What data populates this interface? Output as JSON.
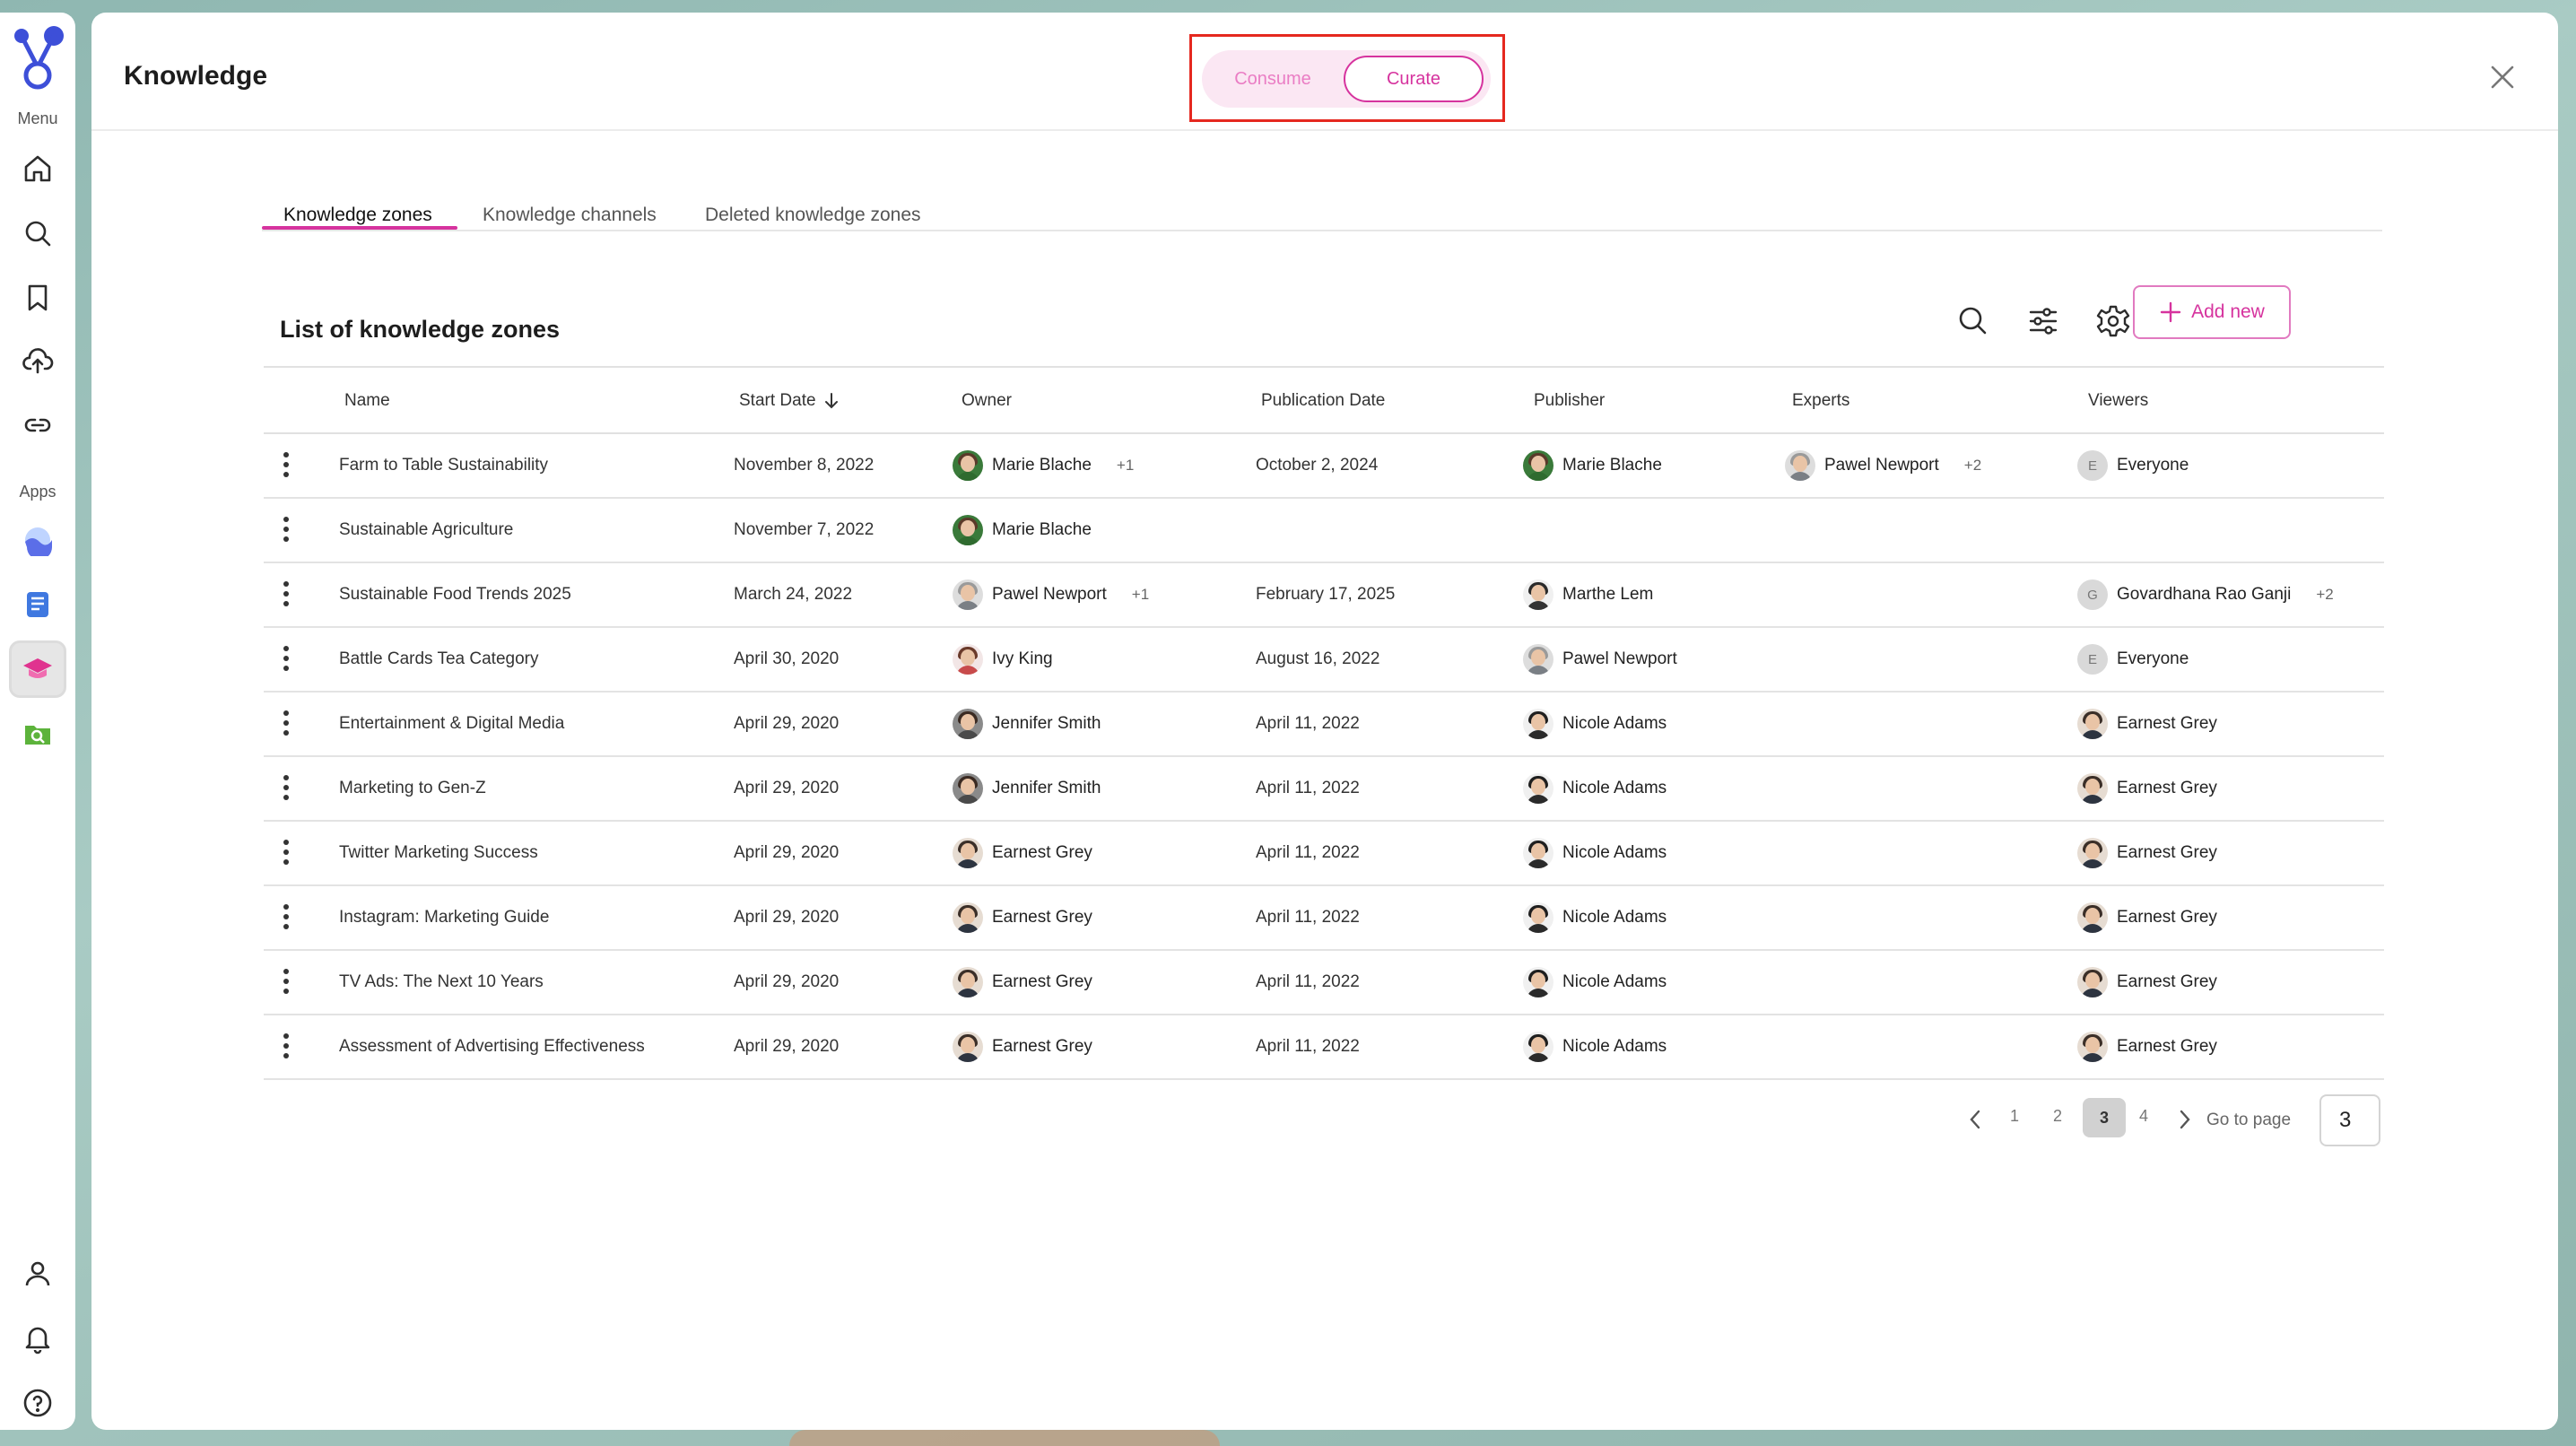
{
  "rail": {
    "menu_label": "Menu",
    "apps_label": "Apps",
    "menu_items": [
      "home-icon",
      "search-icon",
      "bookmark-icon",
      "upload-cloud-icon",
      "link-icon"
    ],
    "app_items": [
      "wave-app-icon",
      "document-app-icon",
      "knowledge-app-icon",
      "search-folder-app-icon"
    ],
    "bottom_items": [
      "user-icon",
      "bell-icon",
      "help-icon"
    ]
  },
  "header": {
    "title": "Knowledge",
    "toggle": {
      "consume": "Consume",
      "curate": "Curate",
      "selected": "Curate"
    }
  },
  "tabs": [
    {
      "label": "Knowledge zones",
      "active": true
    },
    {
      "label": "Knowledge channels",
      "active": false
    },
    {
      "label": "Deleted knowledge zones",
      "active": false
    }
  ],
  "list": {
    "title": "List of knowledge zones",
    "add_label": "Add new",
    "columns": [
      "Name",
      "Start Date",
      "Owner",
      "Publication Date",
      "Publisher",
      "Experts",
      "Viewers"
    ]
  },
  "rows": [
    {
      "name": "Farm to Table Sustainability",
      "start": "November 8, 2022",
      "owner": "Marie Blache",
      "owner_extra": "+1",
      "pub": "October 2, 2024",
      "publisher": "Marie Blache",
      "experts": "Pawel Newport",
      "experts_extra": "+2",
      "viewers": "Everyone",
      "viewers_extra": ""
    },
    {
      "name": "Sustainable Agriculture",
      "start": "November 7, 2022",
      "owner": "Marie Blache",
      "owner_extra": "",
      "pub": "",
      "publisher": "",
      "experts": "",
      "experts_extra": "",
      "viewers": "",
      "viewers_extra": ""
    },
    {
      "name": "Sustainable Food Trends 2025",
      "start": "March 24, 2022",
      "owner": "Pawel Newport",
      "owner_extra": "+1",
      "pub": "February 17, 2025",
      "publisher": "Marthe Lem",
      "experts": "",
      "experts_extra": "",
      "viewers": "Govardhana Rao Ganji",
      "viewers_extra": "+2"
    },
    {
      "name": "Battle Cards Tea Category",
      "start": "April 30, 2020",
      "owner": "Ivy King",
      "owner_extra": "",
      "pub": "August 16, 2022",
      "publisher": "Pawel Newport",
      "experts": "",
      "experts_extra": "",
      "viewers": "Everyone",
      "viewers_extra": ""
    },
    {
      "name": "Entertainment & Digital Media",
      "start": "April 29, 2020",
      "owner": "Jennifer Smith",
      "owner_extra": "",
      "pub": "April 11, 2022",
      "publisher": "Nicole Adams",
      "experts": "",
      "experts_extra": "",
      "viewers": "Earnest Grey",
      "viewers_extra": ""
    },
    {
      "name": "Marketing to Gen-Z",
      "start": "April 29, 2020",
      "owner": "Jennifer Smith",
      "owner_extra": "",
      "pub": "April 11, 2022",
      "publisher": "Nicole Adams",
      "experts": "",
      "experts_extra": "",
      "viewers": "Earnest Grey",
      "viewers_extra": ""
    },
    {
      "name": "Twitter Marketing Success",
      "start": "April 29, 2020",
      "owner": "Earnest Grey",
      "owner_extra": "",
      "pub": "April 11, 2022",
      "publisher": "Nicole Adams",
      "experts": "",
      "experts_extra": "",
      "viewers": "Earnest Grey",
      "viewers_extra": ""
    },
    {
      "name": "Instagram: Marketing Guide",
      "start": "April 29, 2020",
      "owner": "Earnest Grey",
      "owner_extra": "",
      "pub": "April 11, 2022",
      "publisher": "Nicole Adams",
      "experts": "",
      "experts_extra": "",
      "viewers": "Earnest Grey",
      "viewers_extra": ""
    },
    {
      "name": "TV Ads: The Next 10 Years",
      "start": "April 29, 2020",
      "owner": "Earnest Grey",
      "owner_extra": "",
      "pub": "April 11, 2022",
      "publisher": "Nicole Adams",
      "experts": "",
      "experts_extra": "",
      "viewers": "Earnest Grey",
      "viewers_extra": ""
    },
    {
      "name": "Assessment of Advertising Effectiveness",
      "start": "April 29, 2020",
      "owner": "Earnest Grey",
      "owner_extra": "",
      "pub": "April 11, 2022",
      "publisher": "Nicole Adams",
      "experts": "",
      "experts_extra": "",
      "viewers": "Earnest Grey",
      "viewers_extra": ""
    }
  ],
  "pagination": {
    "pages": [
      "1",
      "2",
      "3",
      "4"
    ],
    "current": "3",
    "goto_label": "Go to page",
    "goto_value": "3"
  },
  "colors": {
    "accent": "#d6339e",
    "highlight_frame": "#e5281f"
  }
}
